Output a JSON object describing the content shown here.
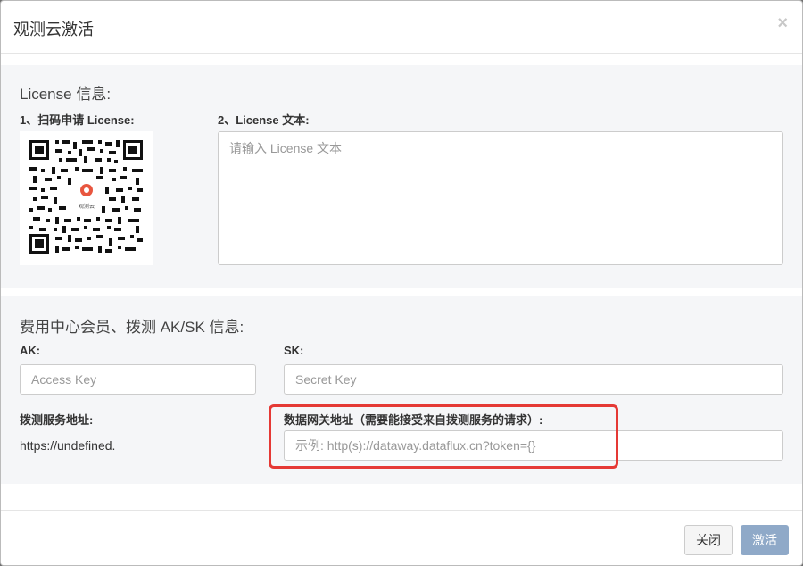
{
  "dialog": {
    "title": "观测云激活",
    "close_glyph": "×"
  },
  "license": {
    "section_title": "License 信息:",
    "qr_label": "1、扫码申请 License:",
    "qr_logo_text": "观测云",
    "text_label": "2、License 文本:",
    "text_placeholder": "请输入 License 文本"
  },
  "aksk": {
    "section_title": "费用中心会员、拨测 AK/SK 信息:",
    "ak_label": "AK:",
    "ak_placeholder": "Access Key",
    "sk_label": "SK:",
    "sk_placeholder": "Secret Key",
    "dial_url_label": "拨测服务地址:",
    "dial_url_value": "https://undefined.",
    "gateway_label": "数据网关地址（需要能接受来自拨测服务的请求）:",
    "gateway_placeholder": "示例: http(s)://dataway.dataflux.cn?token={}"
  },
  "footer": {
    "close_label": "关闭",
    "activate_label": "激活"
  },
  "colors": {
    "highlight": "#e53935",
    "activate_button": "#8fa9c8",
    "section_bg": "#f5f6f8",
    "qr_logo": "#e8563f"
  }
}
